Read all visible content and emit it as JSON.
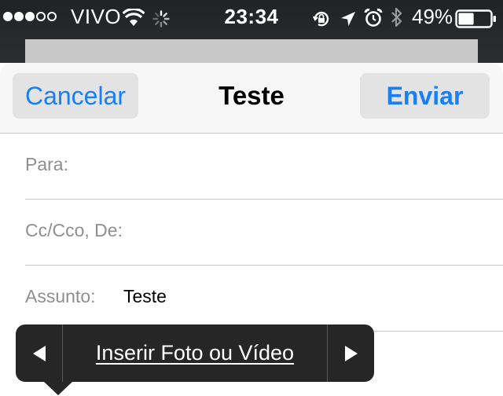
{
  "status_bar": {
    "signal_bars_filled": 3,
    "signal_bars_total": 5,
    "carrier": "VIVO",
    "time": "23:34",
    "battery_percent": "49%",
    "battery_level": 0.49,
    "icons": [
      "wifi-icon",
      "activity-spinner-icon",
      "rotation-lock-icon",
      "location-arrow-icon",
      "alarm-clock-icon",
      "bluetooth-icon",
      "battery-icon"
    ]
  },
  "nav": {
    "cancel_label": "Cancelar",
    "title": "Teste",
    "send_label": "Enviar"
  },
  "fields": {
    "to_label": "Para:",
    "cc_label": "Cc/Cco, De:",
    "subject_label": "Assunto:",
    "subject_value": "Teste"
  },
  "callout": {
    "item_label": "Inserir Foto ou Vídeo"
  },
  "colors": {
    "accent": "#1a7ff5",
    "status_bar_bg": "#202224",
    "callout_bg": "#262626",
    "label_gray": "#8e8e93"
  }
}
